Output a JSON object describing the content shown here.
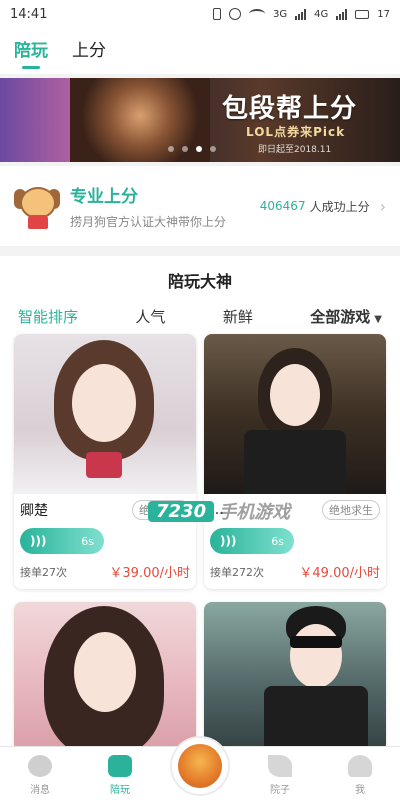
{
  "status_bar": {
    "time": "14:41",
    "net1": "3G",
    "net2": "4G",
    "battery": "17"
  },
  "top_tabs": [
    {
      "label": "陪玩"
    },
    {
      "label": "上分"
    }
  ],
  "banner": {
    "headline": "包段帮上分",
    "subtitle": "LOL点券来Pick",
    "date": "即日起至2018.11"
  },
  "pro": {
    "title": "专业上分",
    "subtitle": "捞月狗官方认证大神带你上分",
    "count": "406467",
    "count_suffix": "人成功上分"
  },
  "section": {
    "title": "陪玩大神"
  },
  "filters": [
    {
      "label": "智能排序"
    },
    {
      "label": "人气"
    },
    {
      "label": "新鲜"
    },
    {
      "label": "全部游戏"
    }
  ],
  "cards": [
    {
      "name": "卿楚",
      "tag": "绝地求生",
      "voice": "6s",
      "orders": "接单27次",
      "price": "￥39.00/小时"
    },
    {
      "name": "…",
      "tag": "绝地求生",
      "voice": "6s",
      "orders": "接单272次",
      "price": "￥49.00/小时"
    },
    {
      "name": "",
      "tag": "",
      "voice": "",
      "orders": "",
      "price": ""
    },
    {
      "name": "",
      "tag": "",
      "voice": "",
      "orders": "",
      "price": ""
    }
  ],
  "watermark": {
    "num": "7230",
    "text": "手机游戏"
  },
  "bottom_nav": [
    {
      "label": "消息"
    },
    {
      "label": "陪玩"
    },
    {
      "label": ""
    },
    {
      "label": "院子"
    },
    {
      "label": "我"
    }
  ],
  "colors": {
    "accent": "#2ab39a",
    "price": "#e84a3a"
  }
}
